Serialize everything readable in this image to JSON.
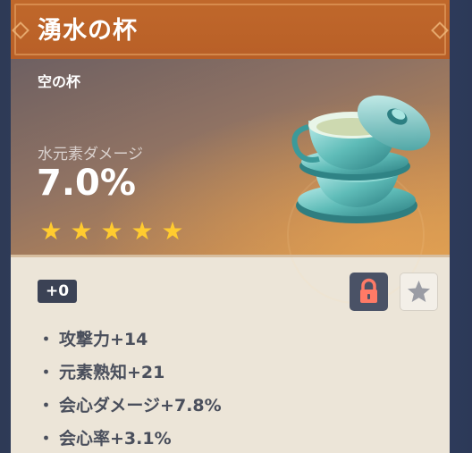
{
  "artifact": {
    "name": "湧水の杯",
    "slot": "空の杯",
    "main_stat": {
      "label": "水元素ダメージ",
      "value": "7.0%"
    },
    "rarity_stars": 5,
    "level": "+0",
    "locked": true,
    "substats": [
      {
        "bullet": "・",
        "text": "攻撃力+14"
      },
      {
        "bullet": "・",
        "text": "元素熟知+21"
      },
      {
        "bullet": "・",
        "text": "会心ダメージ+7.8%"
      },
      {
        "bullet": "・",
        "text": "会心率+3.1%"
      }
    ]
  },
  "icons": {
    "lock": "lock-icon",
    "favorite": "star-icon",
    "rarity": "star-icon",
    "artifact": "teacup-icon"
  },
  "colors": {
    "header": "#b85f27",
    "star": "#ffcb2f",
    "lock_button": "#4a5266",
    "lock_glyph": "#ff7a66",
    "card_body": "#ece5d8",
    "substat_text": "#4a4f5c"
  }
}
